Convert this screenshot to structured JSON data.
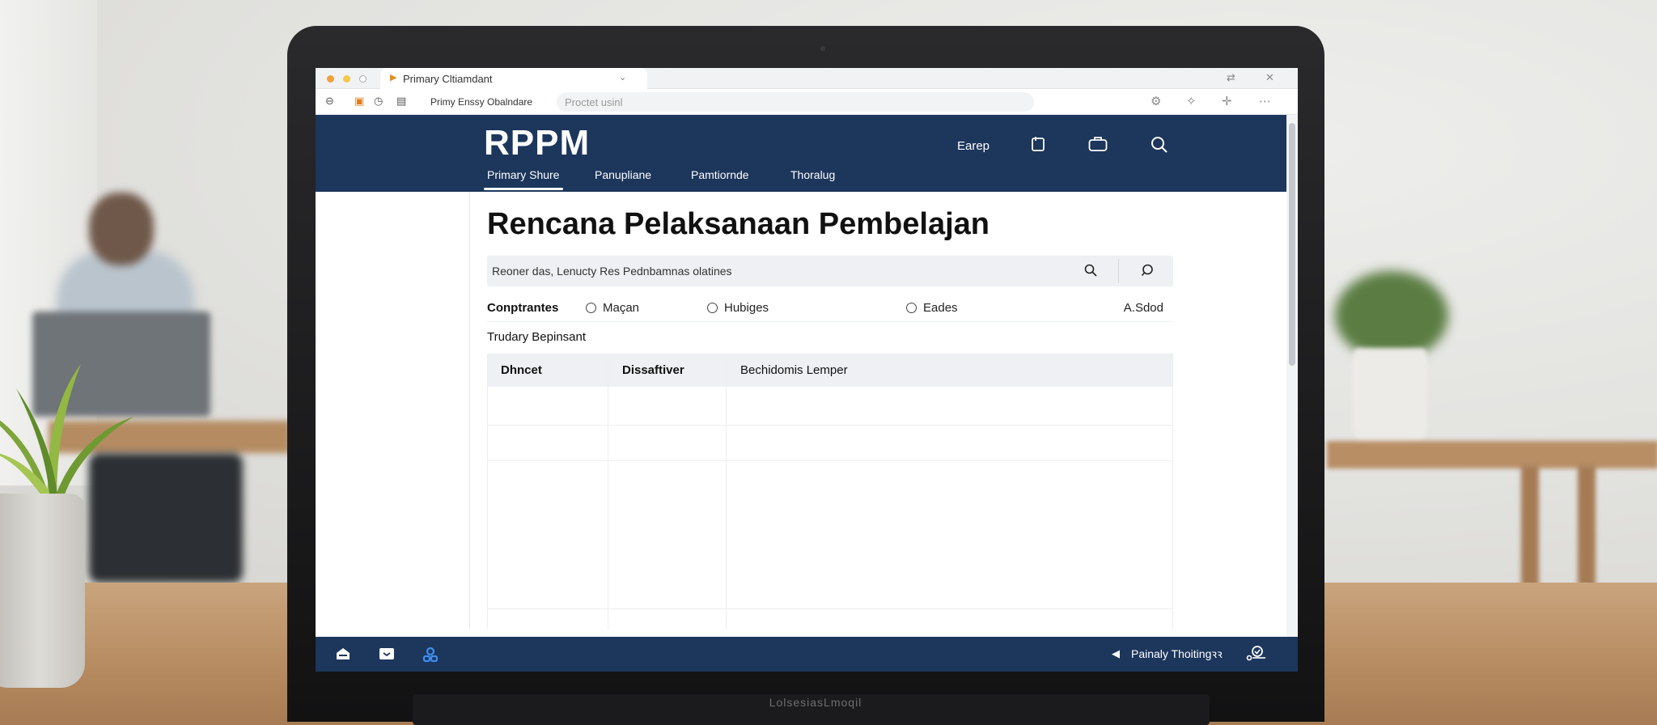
{
  "browser": {
    "tab_title": "Primary Cltiamdant",
    "tab_caret": "⌄",
    "page_label": "Primy Enssy Obalndare",
    "address_placeholder": "Proctet usinl"
  },
  "app": {
    "logo": "RPPM",
    "nav": [
      "Primary Shure",
      "Panupliane",
      "Pamtiornde",
      "Thoralug"
    ],
    "header_link": "Earep",
    "brand_color": "#1c365c"
  },
  "page": {
    "title": "Rencana Pelaksanaan Pembelajan",
    "search_value": "Reoner das, Lenucty Res Pednbamnas olatines",
    "filters": {
      "label": "Conptrantes",
      "options": [
        "Maçan",
        "Hubiges",
        "Eades"
      ],
      "right": "A.Sdod"
    },
    "section_title": "Trudary Bepinsant",
    "table": {
      "headers": [
        "Dhncet",
        "Dissaftiver",
        "Bechidomis Lemper"
      ]
    }
  },
  "taskbar": {
    "status_text": "Painaly Thoiting",
    "status_suffix": "ꝛꝛ"
  },
  "laptop_brand": "LolsesiasLmoqil"
}
